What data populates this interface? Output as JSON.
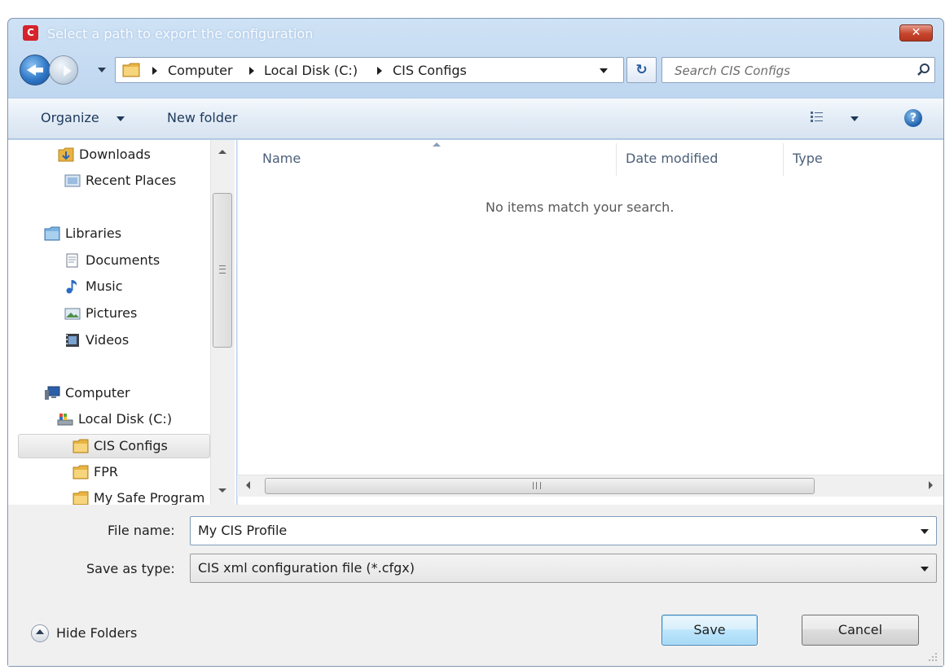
{
  "window": {
    "title": "Select a path to export the configuration",
    "app_icon_letter": "C",
    "close_glyph": "✕"
  },
  "nav": {
    "back_icon": "back-arrow-icon",
    "forward_icon": "forward-arrow-icon"
  },
  "address": {
    "crumbs": [
      "Computer",
      "Local Disk (C:)",
      "CIS Configs"
    ],
    "refresh_glyph": "↻"
  },
  "search": {
    "placeholder": "Search CIS Configs"
  },
  "toolbar": {
    "organize_label": "Organize",
    "new_folder_label": "New folder",
    "help_glyph": "?"
  },
  "sidebar": {
    "items": [
      {
        "label": "Downloads",
        "icon": "downloads-folder-icon"
      },
      {
        "label": "Recent Places",
        "icon": "recent-places-icon"
      },
      {
        "label": "Libraries",
        "icon": "libraries-icon"
      },
      {
        "label": "Documents",
        "icon": "documents-icon"
      },
      {
        "label": "Music",
        "icon": "music-icon"
      },
      {
        "label": "Pictures",
        "icon": "pictures-icon"
      },
      {
        "label": "Videos",
        "icon": "videos-icon"
      },
      {
        "label": "Computer",
        "icon": "computer-icon"
      },
      {
        "label": "Local Disk (C:)",
        "icon": "local-disk-icon"
      },
      {
        "label": "CIS Configs",
        "icon": "folder-icon"
      },
      {
        "label": "FPR",
        "icon": "folder-icon"
      },
      {
        "label": "My Safe Program",
        "icon": "folder-icon"
      }
    ],
    "selected": "CIS Configs"
  },
  "file_list": {
    "columns": [
      "Name",
      "Date modified",
      "Type"
    ],
    "empty_message": "No items match your search.",
    "scroll_grip": "III"
  },
  "form": {
    "file_name_label": "File name:",
    "file_name_value": "My CIS Profile",
    "save_type_label": "Save as type:",
    "save_type_value": "CIS xml configuration file (*.cfgx)"
  },
  "footer": {
    "hide_folders_label": "Hide Folders",
    "save_label": "Save",
    "cancel_label": "Cancel"
  },
  "colors": {
    "title_gradient": "#bcd5ef",
    "close_red": "#c7452c",
    "accent_blue": "#3c7fb1"
  }
}
